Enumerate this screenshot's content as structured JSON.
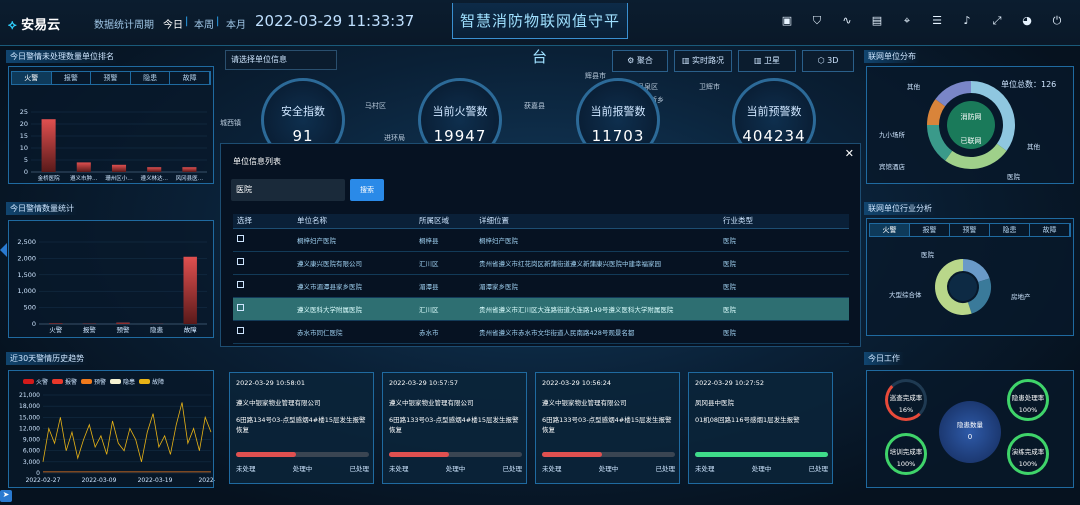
{
  "header": {
    "logo": "安易云",
    "period_label": "数据统计周期",
    "periods": [
      "今日",
      "本周",
      "本月"
    ],
    "datetime": "2022-03-29 11:33:37",
    "title": "智慧消防物联网值守平台"
  },
  "map_labels": [
    {
      "t": "城西镇"
    },
    {
      "t": "马村区"
    },
    {
      "t": "进环局"
    },
    {
      "t": "获嘉县"
    },
    {
      "t": "辉县市"
    },
    {
      "t": "凤泉区"
    },
    {
      "t": "卫辉市"
    },
    {
      "t": "新乡"
    }
  ],
  "search_hint": "请选择单位信息",
  "view_buttons": [
    "聚合",
    "实时路况",
    "卫星",
    "3D"
  ],
  "kpis": [
    {
      "label": "安全指数",
      "value": "91"
    },
    {
      "label": "当前火警数",
      "value": "19947"
    },
    {
      "label": "当前报警数",
      "value": "11703"
    },
    {
      "label": "当前预警数",
      "value": "404234"
    }
  ],
  "ranking": {
    "title": "今日警情未处理数量单位排名",
    "tabs": [
      "火警",
      "报警",
      "预警",
      "隐患",
      "故障"
    ],
    "yticks": [
      "25",
      "20",
      "15",
      "10",
      "5",
      "0"
    ],
    "chart_data": {
      "type": "bar",
      "categories": [
        "金桥医院",
        "遵义市肿…",
        "珊州区小…",
        "遵义林达…",
        "风冈县医…"
      ],
      "values": [
        22,
        4,
        3,
        2,
        2
      ],
      "ylim": [
        0,
        25
      ]
    }
  },
  "stats": {
    "title": "今日警情数量统计",
    "yticks": [
      "2,500",
      "2,000",
      "1,500",
      "1,000",
      "500",
      "0"
    ],
    "chart_data": {
      "type": "bar",
      "categories": [
        "火警",
        "报警",
        "预警",
        "隐患",
        "故障"
      ],
      "values": [
        20,
        10,
        40,
        5,
        2050
      ],
      "ylim": [
        0,
        2500
      ]
    }
  },
  "trend": {
    "title": "近30天警情历史趋势",
    "legend": [
      {
        "name": "火警",
        "color": "#d21a1a"
      },
      {
        "name": "报警",
        "color": "#e8382a"
      },
      {
        "name": "预警",
        "color": "#f07a1c"
      },
      {
        "name": "隐患",
        "color": "#f6f3d2"
      },
      {
        "name": "故障",
        "color": "#e8b316"
      }
    ],
    "yticks": [
      "21,000",
      "18,000",
      "15,000",
      "12,000",
      "9,000",
      "6,000",
      "3,000",
      "0"
    ],
    "xticks": [
      "2022-02-27",
      "2022-03-09",
      "2022-03-19",
      "2022-03"
    ],
    "chart_data": {
      "type": "line",
      "ylim": [
        0,
        21000
      ],
      "series": [
        {
          "name": "故障",
          "values": [
            3000,
            12000,
            8000,
            15000,
            6000,
            11000,
            4000,
            9000,
            13000,
            7000,
            10000,
            5000,
            14000,
            8000,
            6000,
            12000,
            9000,
            3000,
            11000,
            16000,
            7000,
            10000,
            5000,
            13000,
            19000,
            8000,
            12000,
            6000,
            15000,
            11000
          ]
        },
        {
          "name": "火警",
          "values": [
            300,
            300,
            300,
            300,
            300,
            300,
            300,
            300,
            300,
            300,
            300,
            300,
            300,
            300,
            300,
            300,
            300,
            300,
            300,
            300,
            300,
            300,
            300,
            300,
            300,
            300,
            300,
            300,
            300,
            300
          ]
        }
      ]
    }
  },
  "dist": {
    "title": "联网单位分布",
    "center": [
      "消防网",
      "已联网"
    ],
    "labels": [
      "其他",
      "单位总数：126",
      "九小场所",
      "宾馆酒店",
      "医院",
      "其他"
    ],
    "chart_data": {
      "type": "pie",
      "values": [
        35,
        25,
        15,
        10,
        15
      ],
      "colors": [
        "#8fc7e0",
        "#9fd08a",
        "#3a9a8a",
        "#d9843a",
        "#7a86c8"
      ]
    }
  },
  "industry": {
    "title": "联网单位行业分析",
    "tabs": [
      "火警",
      "报警",
      "预警",
      "隐患",
      "故障"
    ],
    "labels": [
      "医院",
      "大型综合体",
      "房地产"
    ],
    "chart_data": {
      "type": "pie",
      "values": [
        20,
        25,
        55
      ],
      "colors": [
        "#6a9ac8",
        "#3a7a9a",
        "#b9d78a"
      ]
    }
  },
  "work": {
    "title": "今日工作",
    "center": {
      "label": "隐患数量",
      "value": "0"
    },
    "rings": [
      {
        "label": "巡查完成率",
        "value": "16%",
        "color": "#e84a3a"
      },
      {
        "label": "隐患处理率",
        "value": "100%",
        "color": "#3fd46a"
      },
      {
        "label": "培训完成率",
        "value": "100%",
        "color": "#3fd46a"
      },
      {
        "label": "演练完成率",
        "value": "100%",
        "color": "#3fd46a"
      }
    ]
  },
  "cards": [
    {
      "time": "2022-03-29 10:58:01",
      "org": "遵义中银家物业管理有限公司",
      "desc": "6田路134号03-点型感烟4#楼15层发生报警恢复",
      "progress": 0.45,
      "color": "#e05050",
      "steps": [
        "未处理",
        "处理中",
        "已处理"
      ]
    },
    {
      "time": "2022-03-29 10:57:57",
      "org": "遵义中银家物业管理有限公司",
      "desc": "6田路133号03-点型感烟4#楼15层发生报警恢复",
      "progress": 0.45,
      "color": "#e05050",
      "steps": [
        "未处理",
        "处理中",
        "已处理"
      ]
    },
    {
      "time": "2022-03-29 10:56:24",
      "org": "遵义中银家物业管理有限公司",
      "desc": "6田路133号03-点型感烟4#楼15层发生报警恢复",
      "progress": 0.45,
      "color": "#e05050",
      "steps": [
        "未处理",
        "处理中",
        "已处理"
      ]
    },
    {
      "time": "2022-03-29 10:27:52",
      "org": "凤冈县中医院",
      "desc": "01机08回路116号感烟1层发生报警",
      "progress": 1.0,
      "color": "#3fdc8a",
      "steps": [
        "未处理",
        "处理中",
        "已处理"
      ]
    }
  ],
  "modal": {
    "title": "单位信息列表",
    "query": "医院",
    "search_btn": "搜索",
    "columns": [
      "选择",
      "单位名称",
      "所属区域",
      "详细位置",
      "行业类型"
    ],
    "rows": [
      [
        "桐梓妇产医院",
        "桐梓县",
        "桐梓妇产医院",
        "医院"
      ],
      [
        "遵义康兴医院有限公司",
        "汇川区",
        "贵州省遵义市红花岗区新蒲街道遵义新蒲康兴医院中建幸福家园",
        "医院"
      ],
      [
        "遵义市湄潭县家乡医院",
        "湄潭县",
        "湄潭家乡医院",
        "医院"
      ],
      [
        "遵义医科大学附属医院",
        "汇川区",
        "贵州省遵义市汇川区大连路街道大连路149号遵义医科大学附属医院",
        "医院"
      ],
      [
        "赤水市同仁医院",
        "赤水市",
        "贵州省遵义市赤水市文华街道人民南路428号观景名都",
        "医院"
      ]
    ],
    "selected": 3
  }
}
